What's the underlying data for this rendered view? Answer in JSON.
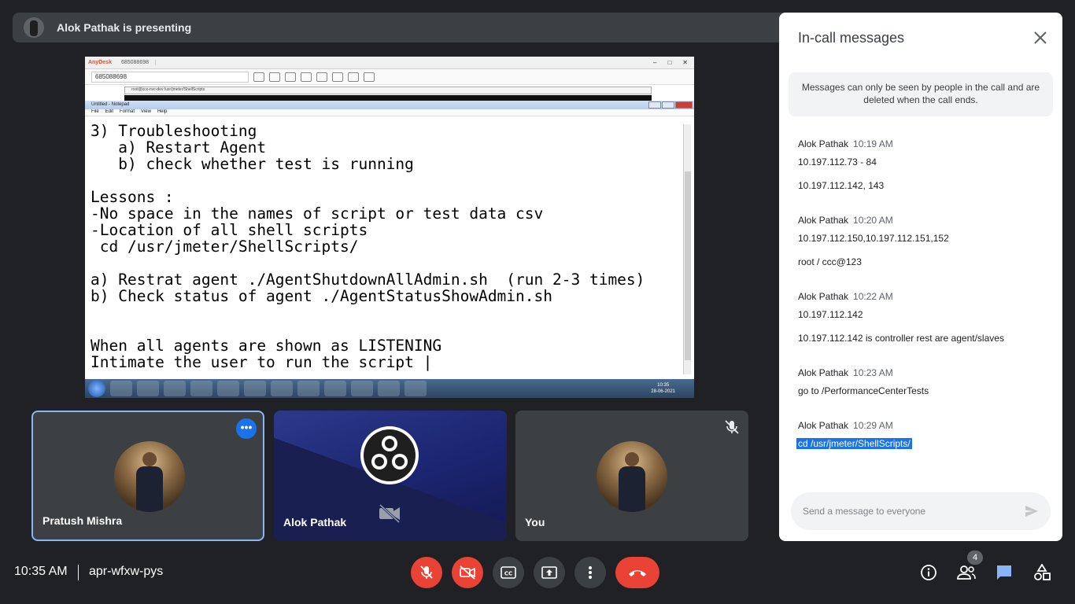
{
  "banner": {
    "text": "Alok Pathak is presenting"
  },
  "shared_screen": {
    "anydesk": {
      "app_name": "AnyDesk",
      "tab_id": "685088698",
      "address": "685088698"
    },
    "remote_window_title": "root@ccc-nvc-dev:/usr/jmeter/ShellScripts",
    "notepad": {
      "title": "Untitled - Notepad",
      "menu": [
        "File",
        "Edit",
        "Format",
        "View",
        "Help"
      ],
      "text": "3) Troubleshooting\n   a) Restart Agent\n   b) check whether test is running\n\nLessons :\n-No space in the names of script or test data csv\n-Location of all shell scripts\n cd /usr/jmeter/ShellScripts/\n\na) Restrat agent ./AgentShutdownAllAdmin.sh  (run 2-3 times)\nb) Check status of agent ./AgentStatusShowAdmin.sh\n\n\nWhen all agents are shown as LISTENING\nIntimate the user to run the script |"
    },
    "taskbar_clock": {
      "time": "10:35",
      "date": "28-06-2021"
    }
  },
  "participants": [
    {
      "name": "Pratush Mishra"
    },
    {
      "name": "Alok Pathak"
    },
    {
      "name": "You"
    }
  ],
  "panel": {
    "title": "In-call messages",
    "notice": "Messages can only be seen by people in the call and are deleted when the call ends.",
    "messages": [
      {
        "sender": "Alok Pathak",
        "time": "10:19 AM",
        "lines": [
          "10.197.112.73 - 84",
          "10.197.112.142, 143"
        ]
      },
      {
        "sender": "Alok Pathak",
        "time": "10:20 AM",
        "lines": [
          "10.197.112.150,10.197.112.151,152",
          "root / ccc@123"
        ]
      },
      {
        "sender": "Alok Pathak",
        "time": "10:22 AM",
        "lines": [
          "10.197.112.142",
          "10.197.112.142 is controller rest are agent/slaves"
        ]
      },
      {
        "sender": "Alok Pathak",
        "time": "10:23 AM",
        "lines": [
          "go to /PerformanceCenterTests"
        ]
      },
      {
        "sender": "Alok Pathak",
        "time": "10:29 AM",
        "lines": [
          "cd /usr/jmeter/ShellScripts/"
        ]
      }
    ],
    "input_placeholder": "Send a message to everyone"
  },
  "bottom_bar": {
    "time": "10:35 AM",
    "meeting_code": "apr-wfxw-pys",
    "participant_count": "4"
  },
  "colors": {
    "accent": "#1a73e8",
    "danger": "#ea4335",
    "background": "#202124",
    "tile": "#3c4043"
  }
}
